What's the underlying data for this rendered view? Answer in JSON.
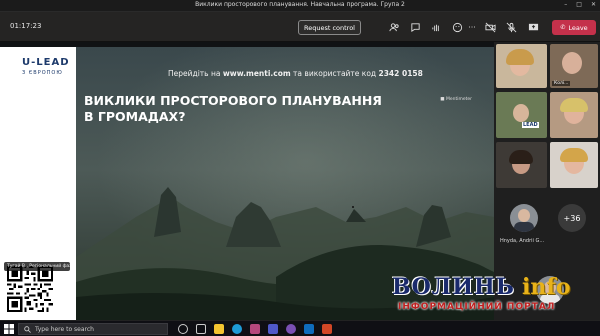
{
  "window": {
    "title": "Виклики просторового планування. Навчальна програма. Група 2",
    "minimize": "–",
    "maximize": "□",
    "close": "✕"
  },
  "toolbar": {
    "timer": "01:17:23",
    "request_control": "Request control",
    "leave": "Leave",
    "icons": [
      "people-icon",
      "chat-icon",
      "raise-hand-icon",
      "reactions-icon",
      "more-icon",
      "camera-off-icon",
      "mic-off-icon",
      "share-icon",
      "phone-icon"
    ]
  },
  "slide": {
    "menti_prefix": "Перейдіть на ",
    "menti_site": "www.menti.com",
    "menti_middle": " та використайте код ",
    "menti_code": "2342 0158",
    "brand": "Mentimeter",
    "title": "ВИКЛИКИ ПРОСТОРОВОГО ПЛАНУВАННЯ В ГРОМАДАХ?"
  },
  "presenter_panel": {
    "logo": "U-LEAD",
    "logo_sub": "З ЄВРОПОЮ",
    "caption": "Тугай В., Регіональний фахівець (Guest)"
  },
  "participants": {
    "tiles": [
      {
        "name": ""
      },
      {
        "name": "Колі..."
      },
      {
        "name": ""
      },
      {
        "name": ""
      },
      {
        "name": ""
      },
      {
        "name": ""
      }
    ],
    "people": [
      {
        "name": "Hnyda, Andrii G..."
      }
    ],
    "overflow": "+36"
  },
  "taskbar": {
    "search_placeholder": "Type here to search"
  },
  "watermark": {
    "part1": "ВОЛИНЬ",
    "part2": "info",
    "tagline": "ІНФОРМАЦІЙНИЙ ПОРТАЛ"
  }
}
